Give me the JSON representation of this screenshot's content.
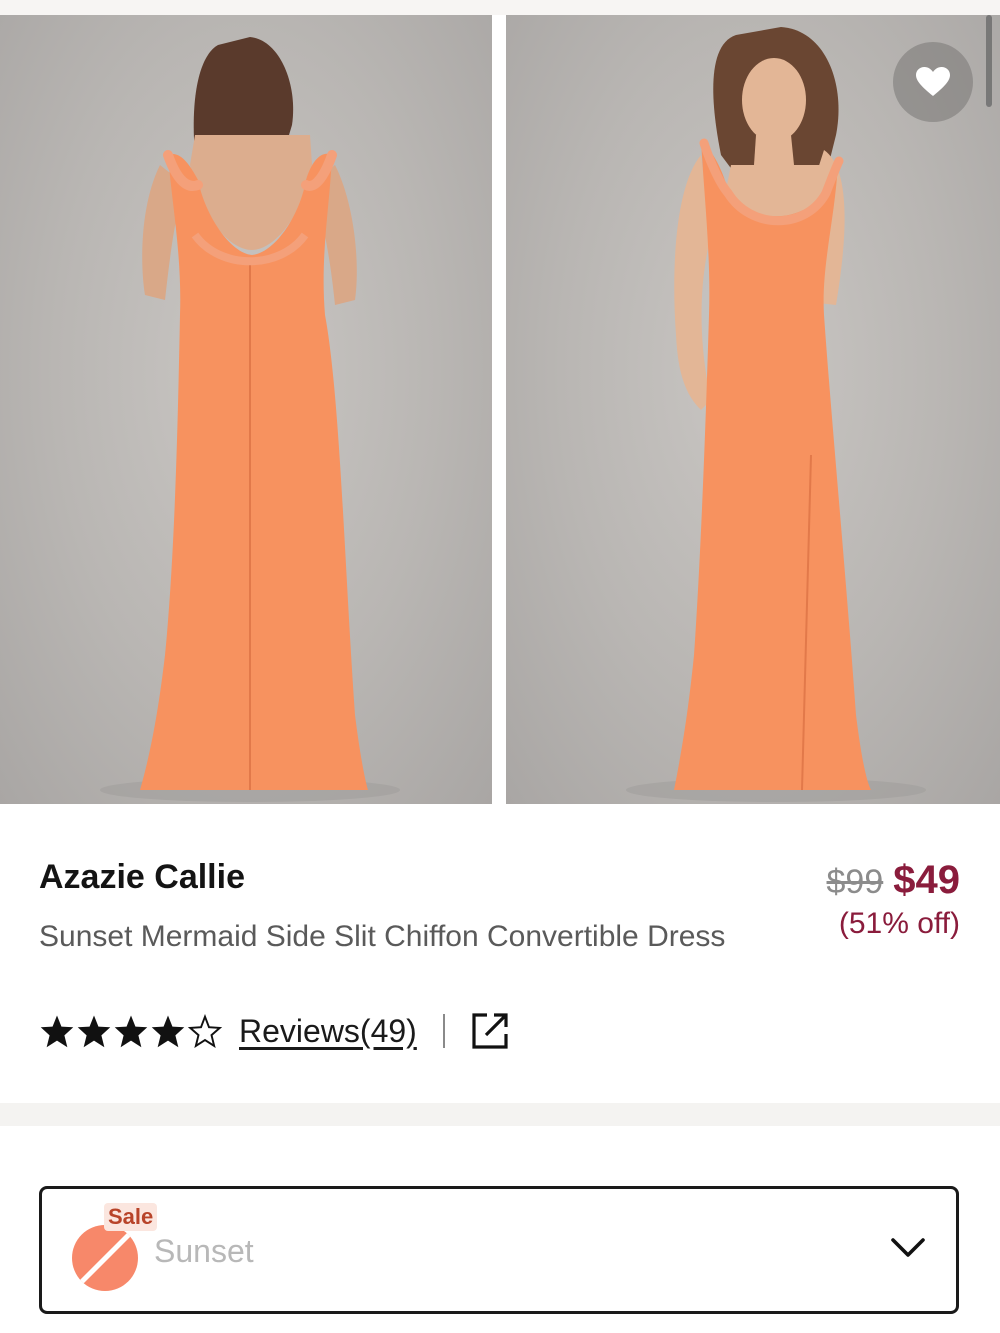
{
  "gallery": {
    "images": [
      {
        "alt": "Back view of model wearing orange mermaid dress with ruffled straps"
      },
      {
        "alt": "Front view of model wearing orange mermaid dress with ruffled neckline"
      }
    ],
    "wishlist_icon": "heart-icon"
  },
  "product": {
    "brand": "Azazie Callie",
    "subtitle": "Sunset Mermaid Side Slit Chiffon Convertible Dress",
    "price": {
      "original": "$99",
      "sale": "$49",
      "discount": "(51% off)"
    },
    "rating": {
      "stars": 4,
      "max": 5,
      "reviews_label": "Reviews(49)"
    },
    "share_icon": "external-link-icon"
  },
  "color_selector": {
    "badge": "Sale",
    "value": "Sunset",
    "swatch_color": "#f7886a",
    "chevron_icon": "chevron-down-icon"
  },
  "colors": {
    "price_accent": "#8a1c3c",
    "dress": "#f7925f"
  }
}
